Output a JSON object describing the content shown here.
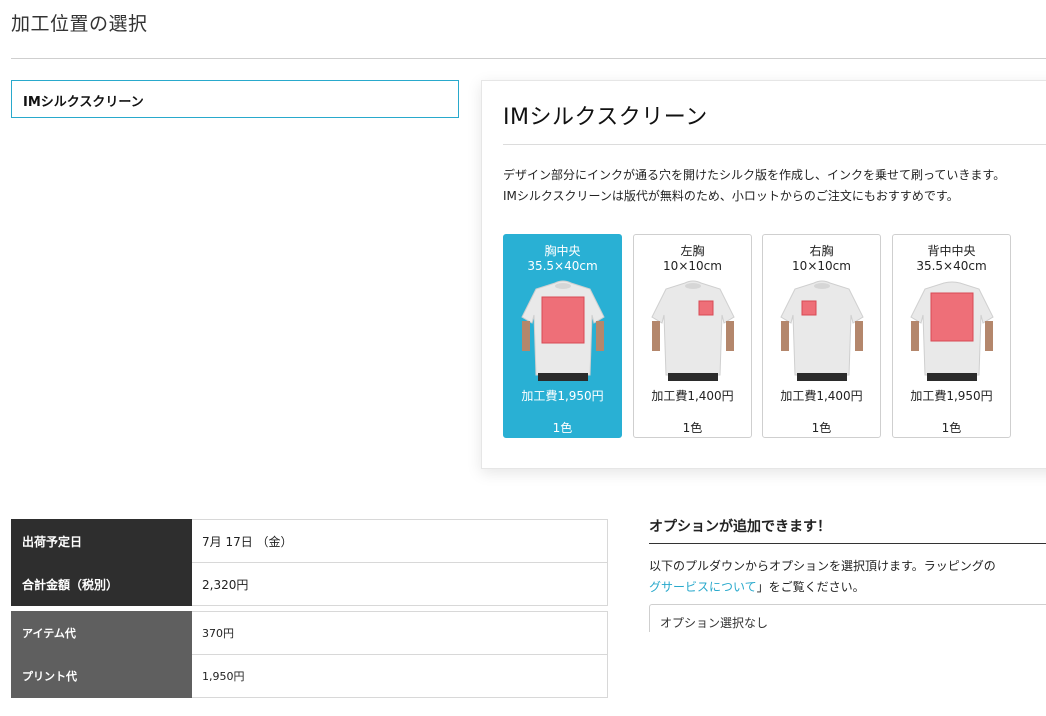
{
  "page": {
    "title": "加工位置の選択"
  },
  "method": {
    "selected": "IMシルクスクリーン"
  },
  "panel": {
    "title": "IMシルクスクリーン",
    "desc_line1": "デザイン部分にインクが通る穴を開けたシルク版を作成し、インクを乗せて刷っていきます。",
    "desc_line2": "IMシルクスクリーンは版代が無料のため、小ロットからのご注文にもおすすめです。"
  },
  "positions": [
    {
      "name": "胸中央",
      "size": "35.5×40cm",
      "price": "加工費1,950円",
      "colors": "1色",
      "selected": true
    },
    {
      "name": "左胸",
      "size": "10×10cm",
      "price": "加工費1,400円",
      "colors": "1色",
      "selected": false
    },
    {
      "name": "右胸",
      "size": "10×10cm",
      "price": "加工費1,400円",
      "colors": "1色",
      "selected": false
    },
    {
      "name": "背中中央",
      "size": "35.5×40cm",
      "price": "加工費1,950円",
      "colors": "1色",
      "selected": false
    }
  ],
  "summary": {
    "ship_date_label": "出荷予定日",
    "ship_date_value": "7月 17日 （金）",
    "total_label": "合計金額（税別）",
    "total_value": "2,320円",
    "item_label": "アイテム代",
    "item_value": "370円",
    "print_label": "プリント代",
    "print_value": "1,950円"
  },
  "options": {
    "title": "オプションが追加できます！",
    "text_line1": "以下のプルダウンからオプションを選択頂けます。ラッピングの",
    "text_link": "グサービスについて",
    "text_line2_rest": "」をご覧ください。",
    "select_value": "オプション選択なし"
  },
  "colors": {
    "accent": "#29b0d4",
    "print_area": "#ee6f78",
    "dark_label": "#2e2e2e",
    "mid_label": "#5f5f5f"
  }
}
